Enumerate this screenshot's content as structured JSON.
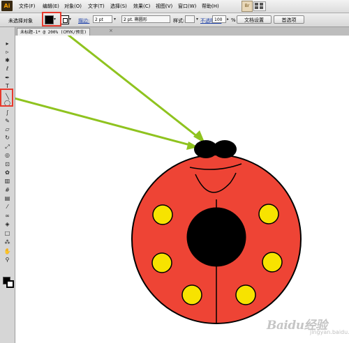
{
  "app": {
    "logo_text": "Ai"
  },
  "menu": {
    "items": [
      "文件(F)",
      "编辑(E)",
      "对象(O)",
      "文字(T)",
      "选择(S)",
      "效果(C)",
      "视图(V)",
      "窗口(W)",
      "帮助(H)"
    ],
    "bridge_label": "Br"
  },
  "control_bar": {
    "selection_status": "未选择对象",
    "stroke_label": "描边:",
    "stroke_weight": "2 pt",
    "brush_label": "2 pt. 椭圆形",
    "style_label": "样式:",
    "opacity_label": "不透明度:",
    "opacity_value": "100",
    "opacity_unit": "%",
    "doc_setup_button": "文档设置",
    "preferences_button": "首选项"
  },
  "document": {
    "tab_title": "未标题-1* @ 200% (CMYK/预览)",
    "close_glyph": "×"
  },
  "toolbox": {
    "tools": [
      {
        "name": "selection-tool",
        "glyph": "▸"
      },
      {
        "name": "direct-selection-tool",
        "glyph": "▹"
      },
      {
        "name": "magic-wand-tool",
        "glyph": "✱"
      },
      {
        "name": "lasso-tool",
        "glyph": "ℓ"
      },
      {
        "name": "pen-tool",
        "glyph": "✒"
      },
      {
        "name": "type-tool",
        "glyph": "T"
      },
      {
        "name": "line-tool",
        "glyph": "╲"
      },
      {
        "name": "ellipse-tool",
        "glyph": "◯"
      },
      {
        "name": "paintbrush-tool",
        "glyph": "∫"
      },
      {
        "name": "pencil-tool",
        "glyph": "✎"
      },
      {
        "name": "eraser-tool",
        "glyph": "▱"
      },
      {
        "name": "rotate-tool",
        "glyph": "↻"
      },
      {
        "name": "scale-tool",
        "glyph": "⤢"
      },
      {
        "name": "warp-tool",
        "glyph": "◎"
      },
      {
        "name": "free-transform-tool",
        "glyph": "⊡"
      },
      {
        "name": "symbol-sprayer-tool",
        "glyph": "✿"
      },
      {
        "name": "graph-tool",
        "glyph": "▥"
      },
      {
        "name": "mesh-tool",
        "glyph": "#"
      },
      {
        "name": "gradient-tool",
        "glyph": "▤"
      },
      {
        "name": "eyedropper-tool",
        "glyph": "⁄"
      },
      {
        "name": "blend-tool",
        "glyph": "∞"
      },
      {
        "name": "live-paint-tool",
        "glyph": "◈"
      },
      {
        "name": "artboard-tool",
        "glyph": "□"
      },
      {
        "name": "slice-tool",
        "glyph": "⁂"
      },
      {
        "name": "hand-tool",
        "glyph": "✋"
      },
      {
        "name": "zoom-tool",
        "glyph": "⚲"
      }
    ]
  },
  "artwork": {
    "colors": {
      "body": "#ee4435",
      "spots": "#f7e300",
      "head": "#000000",
      "arrow": "#8fc31f",
      "highlight": "#e8392c"
    }
  },
  "watermark": {
    "text": "Baidu经验",
    "sub": "jingyan.baidu.com"
  }
}
